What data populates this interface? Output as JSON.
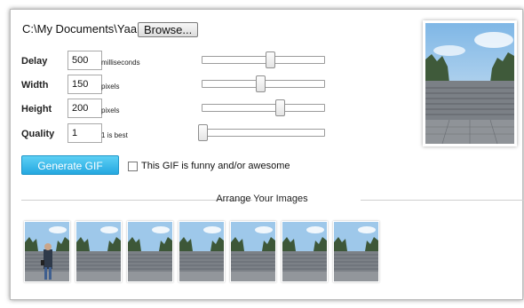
{
  "file": {
    "path_value": "C:\\My Documents\\Yaa",
    "browse_label": "Browse..."
  },
  "params": {
    "delay": {
      "label": "Delay",
      "value": "500",
      "unit": "milliseconds",
      "slider_level": 0.57
    },
    "width": {
      "label": "Width",
      "value": "150",
      "unit": "pixels",
      "slider_level": 0.48
    },
    "height": {
      "label": "Height",
      "value": "200",
      "unit": "pixels",
      "slider_level": 0.65
    },
    "quality": {
      "label": "Quality",
      "value": "1",
      "unit": "1 is best",
      "slider_level": 0.0
    }
  },
  "actions": {
    "generate_label": "Generate GIF",
    "funny_label": "This GIF is funny and/or awesome",
    "funny_checked": false
  },
  "arrange": {
    "title": "Arrange Your Images"
  },
  "colors": {
    "accent": "#29abe2",
    "sky": "#9ec8ea"
  },
  "thumbnails": [
    {
      "kind": "person-on-stairs"
    },
    {
      "kind": "stairs"
    },
    {
      "kind": "stairs"
    },
    {
      "kind": "stairs"
    },
    {
      "kind": "stairs"
    },
    {
      "kind": "stairs"
    },
    {
      "kind": "stairs"
    }
  ]
}
